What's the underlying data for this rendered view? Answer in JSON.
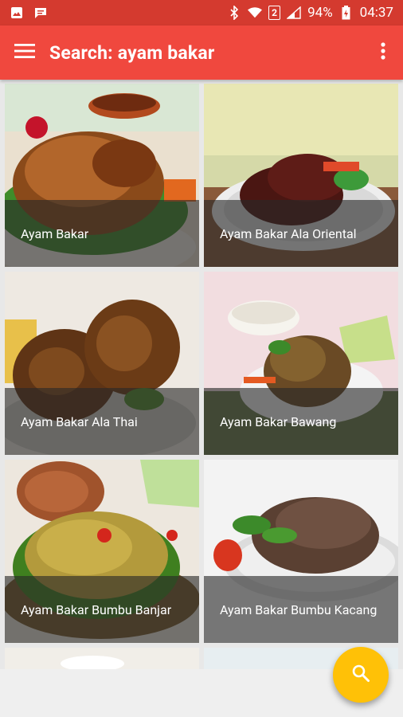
{
  "status_bar": {
    "battery_percent": "94%",
    "time": "04:37",
    "sim": "2"
  },
  "app_bar": {
    "title": "Search: ayam bakar"
  },
  "results": [
    {
      "name": "Ayam Bakar"
    },
    {
      "name": "Ayam Bakar Ala Oriental"
    },
    {
      "name": "Ayam Bakar Ala Thai"
    },
    {
      "name": "Ayam Bakar Bawang"
    },
    {
      "name": "Ayam Bakar Bumbu Banjar"
    },
    {
      "name": "Ayam Bakar Bumbu Kacang"
    }
  ],
  "colors": {
    "status_bar": "#d43a2f",
    "app_bar": "#f0483e",
    "fab": "#ffc107"
  },
  "icons": {
    "menu": "hamburger-icon",
    "more": "more-vert-icon",
    "fab": "search-icon"
  }
}
